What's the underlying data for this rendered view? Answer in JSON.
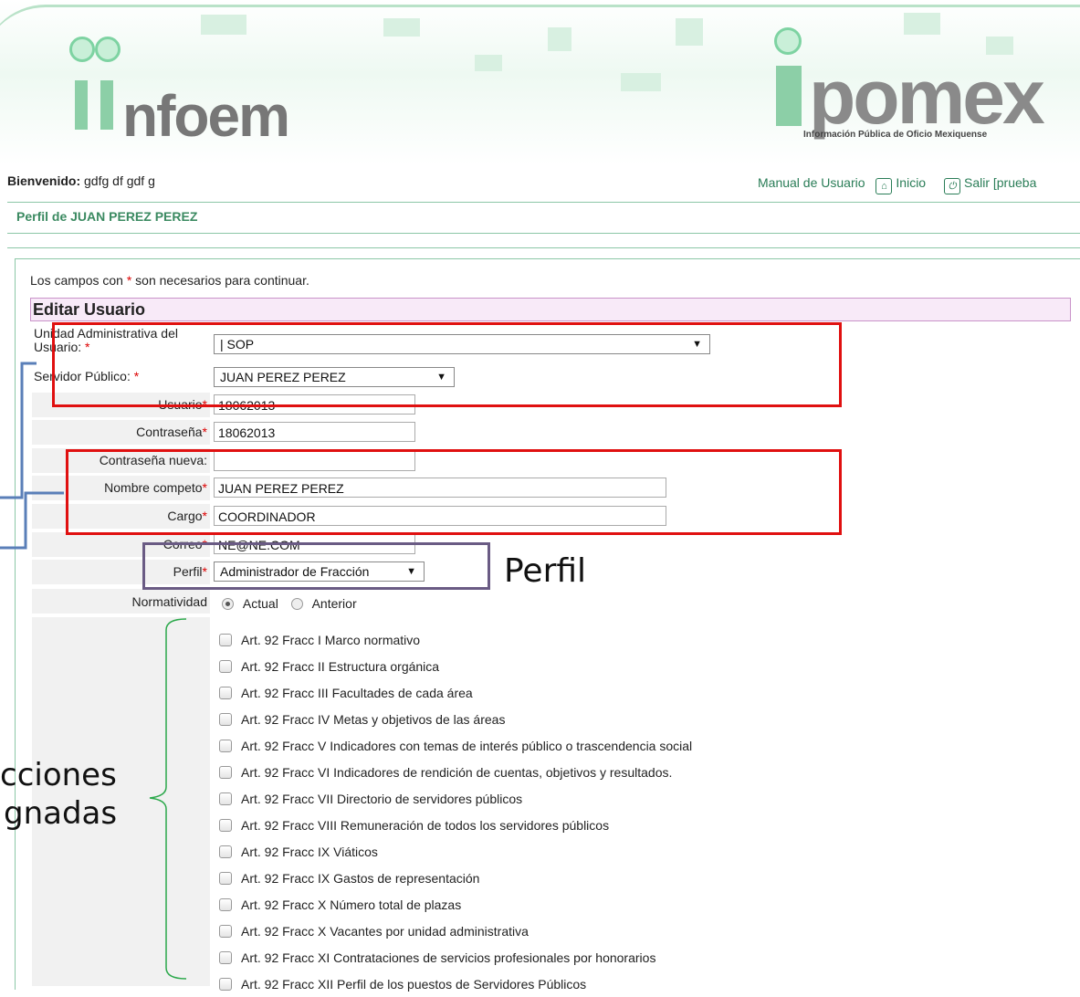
{
  "header": {
    "logo_left": "nfoem",
    "logo_right": "pomex",
    "logo_right_subtitle": "Información Pública de Oficio Mexiquense"
  },
  "topbar": {
    "welcome_label": "Bienvenido:",
    "welcome_user": "gdfg df gdf g",
    "manual_link": "Manual de Usuario",
    "home_link": "Inicio",
    "logout_link": "Salir [prueba"
  },
  "profile_title": "Perfil de JUAN PEREZ PEREZ",
  "form": {
    "required_note_a": "Los campos con ",
    "required_note_star": "*",
    "required_note_b": " son necesarios para continuar.",
    "section_title": "Editar Usuario",
    "unidad_label": "Unidad Administrativa del Usuario:",
    "unidad_value": "| SOP",
    "servidor_label": "Servidor Público:",
    "servidor_value": "JUAN PEREZ PEREZ",
    "usuario_label": "Usuario",
    "usuario_value": "18062013",
    "contrasena_label": "Contraseña",
    "contrasena_value": "18062013",
    "contrasena_nueva_label": "Contraseña nueva:",
    "contrasena_nueva_value": "",
    "nombre_label": "Nombre competo",
    "nombre_value": "JUAN PEREZ PEREZ",
    "cargo_label": "Cargo",
    "cargo_value": "COORDINADOR",
    "correo_label": "Correo",
    "correo_value": "NE@NE.COM",
    "perfil_label": "Perfil",
    "perfil_value": "Administrador de Fracción",
    "normatividad_label": "Normatividad",
    "normatividad_options": [
      "Actual",
      "Anterior"
    ],
    "normatividad_selected": "Actual",
    "req_star": "*"
  },
  "fracciones": [
    "Art. 92 Fracc I Marco normativo",
    "Art. 92 Fracc II Estructura orgánica",
    "Art. 92 Fracc III Facultades de cada área",
    "Art. 92 Fracc IV Metas y objetivos de las áreas",
    "Art. 92 Fracc V Indicadores con temas de interés público o trascendencia social",
    "Art. 92 Fracc VI Indicadores de rendición de cuentas, objetivos y resultados.",
    "Art. 92 Fracc VII Directorio de servidores públicos",
    "Art. 92 Fracc VIII Remuneración de todos los servidores públicos",
    "Art. 92 Fracc IX Viáticos",
    "Art. 92 Fracc IX Gastos de representación",
    "Art. 92 Fracc X Número total de plazas",
    "Art. 92 Fracc X Vacantes por unidad administrativa",
    "Art. 92 Fracc XI Contrataciones de servicios profesionales por honorarios",
    "Art. 92 Fracc XII Perfil de los puestos de Servidores Públicos"
  ],
  "annotations": {
    "perfil": "Perfil",
    "fracciones_line1": "cciones",
    "fracciones_line2": "gnadas"
  },
  "colors": {
    "accent": "#2a7d57",
    "highlight_red": "#e01010",
    "highlight_purple": "#6a5b84",
    "section_bg": "#f8eaf8"
  }
}
